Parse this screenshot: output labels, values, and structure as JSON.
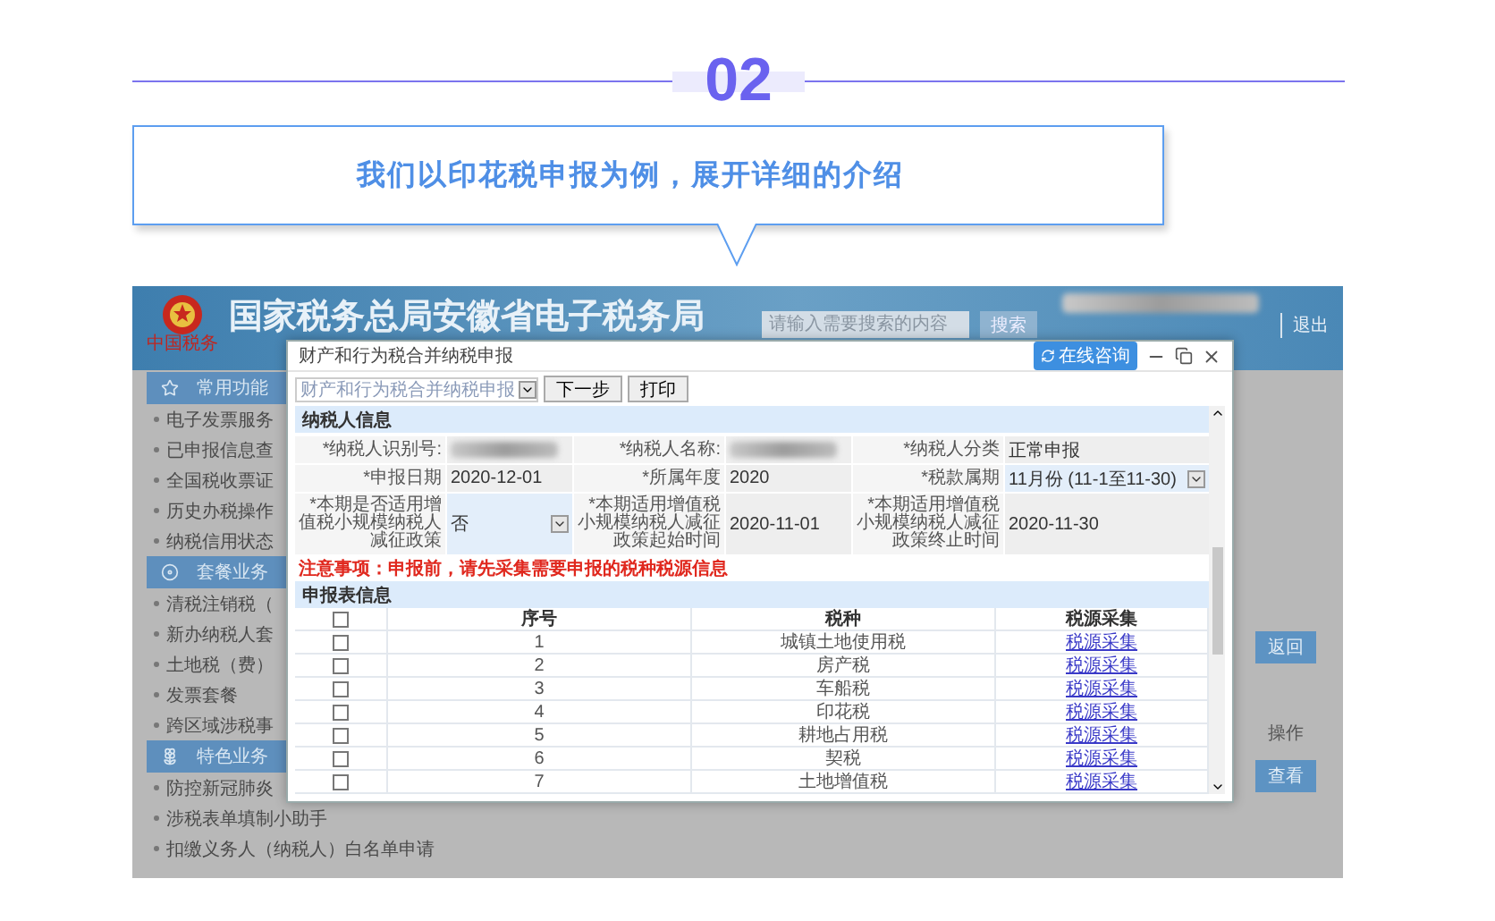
{
  "divider": {
    "number": "02"
  },
  "callout": {
    "text": "我们以印花税申报为例，展开详细的介绍"
  },
  "portal": {
    "title": "国家税务总局安徽省电子税务局",
    "logo_caption": "中国税务",
    "search": {
      "placeholder": "请输入需要搜索的内容",
      "button": "搜索"
    },
    "logout": "退出",
    "sidebar": [
      {
        "title": "常用功能",
        "items": [
          "电子发票服务",
          "已申报信息查",
          "全国税收票证",
          "历史办税操作",
          "纳税信用状态"
        ]
      },
      {
        "title": "套餐业务",
        "items": [
          "清税注销税（",
          "新办纳税人套",
          "土地税（费）",
          "发票套餐",
          "跨区域涉税事"
        ]
      },
      {
        "title": "特色业务",
        "items": [
          "防控新冠肺炎",
          "涉税表单填制小助手",
          "扣缴义务人（纳税人）白名单申请"
        ]
      }
    ],
    "return_button": "返回",
    "column_header": "操作",
    "view_button": "查看"
  },
  "dialog": {
    "title": "财产和行为税合并纳税申报",
    "help_button": "在线咨询",
    "toolbar": {
      "select": "财产和行为税合并纳税申报",
      "buttons": [
        "下一步",
        "打印"
      ]
    },
    "taxpayer_section": {
      "title": "纳税人信息",
      "fields": [
        {
          "label": "*纳税人识别号:",
          "kind": "blurred"
        },
        {
          "label": "*纳税人名称:",
          "kind": "blurred"
        },
        {
          "label": "*纳税人分类",
          "kind": "text",
          "value": "正常申报"
        },
        {
          "label": "*申报日期",
          "kind": "text",
          "value": "2020-12-01"
        },
        {
          "label": "*所属年度",
          "kind": "text",
          "value": "2020"
        },
        {
          "label": "*税款属期",
          "kind": "select",
          "value": "11月份 (11-1至11-30)"
        },
        {
          "label": "*本期是否适用增值税小规模纳税人减征政策",
          "kind": "select",
          "value": "否"
        },
        {
          "label": "*本期适用增值税小规模纳税人减征政策起始时间",
          "kind": "text",
          "value": "2020-11-01"
        },
        {
          "label": "*本期适用增值税小规模纳税人减征政策终止时间",
          "kind": "text",
          "value": "2020-11-30"
        }
      ],
      "notice": "注意事项：申报前，请先采集需要申报的税种税源信息"
    },
    "declaration_section": {
      "title": "申报表信息",
      "all_selected": false,
      "columns": [
        "序号",
        "税种",
        "税源采集"
      ],
      "rows": [
        {
          "selected": false,
          "number": "1",
          "tax": "城镇土地使用税",
          "link": "税源采集"
        },
        {
          "selected": false,
          "number": "2",
          "tax": "房产税",
          "link": "税源采集"
        },
        {
          "selected": false,
          "number": "3",
          "tax": "车船税",
          "link": "税源采集"
        },
        {
          "selected": false,
          "number": "4",
          "tax": "印花税",
          "link": "税源采集"
        },
        {
          "selected": false,
          "number": "5",
          "tax": "耕地占用税",
          "link": "税源采集"
        },
        {
          "selected": false,
          "number": "6",
          "tax": "契税",
          "link": "税源采集"
        },
        {
          "selected": false,
          "number": "7",
          "tax": "土地增值税",
          "link": "税源采集"
        }
      ]
    }
  }
}
